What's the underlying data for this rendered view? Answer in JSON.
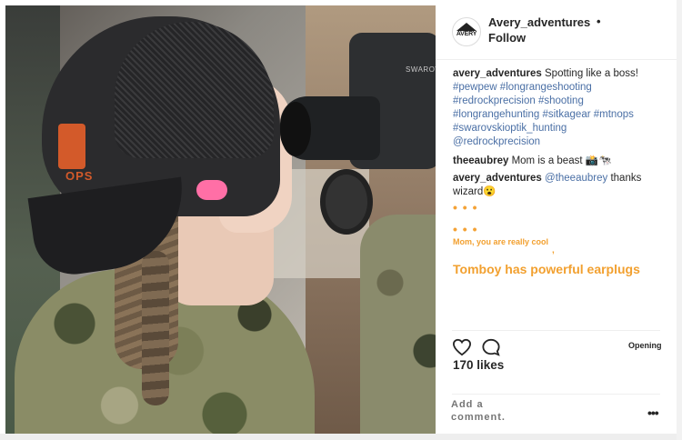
{
  "post": {
    "username": "Avery_adventures",
    "separator": "•",
    "follow_label": "Follow",
    "avatar_text": "AVERY",
    "scope_brand": "SWAROV",
    "cap_logo_text": "OPS"
  },
  "caption": {
    "user": "avery_adventures",
    "text": "Spotting like a boss!",
    "hashtags": [
      "#pewpew",
      "#longrangeshooting",
      "#redrockprecision",
      "#shooting",
      "#longrangehunting",
      "#sitkagear",
      "#mtnops",
      "#swarovskioptik_hunting",
      "@redrockprecision"
    ]
  },
  "comments": [
    {
      "user": "theeaubrey",
      "text": "Mom is a beast 📸🐄"
    },
    {
      "user": "avery_adventures",
      "mention": "@theeaubrey",
      "text": "thanks wizard😮"
    }
  ],
  "annotations": {
    "dots_1": "• • •",
    "dots_2": "• • •",
    "small_text": "Mom, you are really cool",
    "comma": ",",
    "big_text": "Tomboy has powerful earplugs"
  },
  "actions": {
    "heart_icon": "heart-icon",
    "comment_icon": "comment-bubble-icon",
    "opening_label": "Opening",
    "likes": "170 likes",
    "add_comment_placeholder": "Add a comment.",
    "more_dots": "•••"
  },
  "colors": {
    "accent_orange": "#f2a02f",
    "link_blue": "#4a6fa5",
    "text_dark": "#262626",
    "earplug_pink": "#ff6fa6"
  }
}
